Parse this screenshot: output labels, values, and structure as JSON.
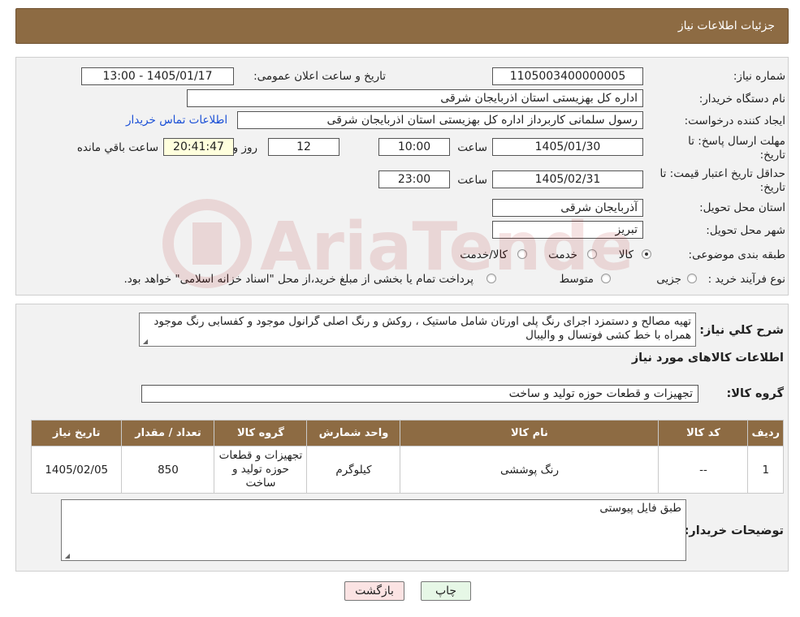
{
  "header": {
    "title": "جزئیات اطلاعات نیاز"
  },
  "form": {
    "need_number_label": "شماره نیاز:",
    "need_number": "1105003400000005",
    "announce_label": "تاریخ و ساعت اعلان عمومی:",
    "announce_value": "1405/01/17 - 13:00",
    "buyer_org_label": "نام دستگاه خریدار:",
    "buyer_org": "اداره کل بهزیستی استان اذربایجان شرقی",
    "requester_label": "ایجاد کننده درخواست:",
    "requester": "رسول سلمانی کاربرداز اداره کل بهزیستی استان اذربایجان شرقی",
    "contact_link": "اطلاعات تماس خریدار",
    "send_deadline_label_line1": "مهلت ارسال پاسخ: تا",
    "send_deadline_label_line2": "تاریخ:",
    "send_date": "1405/01/30",
    "time_label": "ساعت",
    "send_time": "10:00",
    "days_value": "12",
    "days_label": "روز و",
    "remaining_time": "20:41:47",
    "remaining_label": "ساعت باقي مانده",
    "price_validity_label_line1": "حداقل تاریخ اعتبار قیمت: تا",
    "price_validity_label_line2": "تاریخ:",
    "validity_date": "1405/02/31",
    "validity_time": "23:00",
    "province_label": "استان محل تحویل:",
    "province": "آذربایجان شرقی",
    "city_label": "شهر محل تحویل:",
    "city": "تبریز",
    "category_label": "طبقه بندی موضوعی:",
    "category_options": [
      "کالا",
      "خدمت",
      "کالا/خدمت"
    ],
    "process_label": "نوع فرآیند خرید :",
    "process_options": [
      "جزیی",
      "متوسط"
    ],
    "process_note": "پرداخت تمام یا بخشی از مبلغ خرید،از محل \"اسناد خزانه اسلامی\" خواهد بود."
  },
  "description": {
    "label": "شرح كلي نياز:",
    "text": "تهیه مصالح و دستمزد اجرای رنگ پلی اورتان شامل ماستیک ، روکش و رنگ اصلی گرانول موجود و کفسابی رنگ موجود همراه با خط کشی فوتسال و والیبال"
  },
  "goods": {
    "section_title": "اطلاعات کالاهای مورد نیاز",
    "group_label": "گروه کالا:",
    "group_value": "تجهیزات و قطعات حوزه تولید و ساخت",
    "columns": [
      "ردیف",
      "کد کالا",
      "نام کالا",
      "واحد شمارش",
      "گروه کالا",
      "تعداد / مقدار",
      "تاریخ نیاز"
    ],
    "rows": [
      [
        "1",
        "--",
        "رنگ پوششی",
        "کیلوگرم",
        "تجهیزات و قطعات حوزه تولید و ساخت",
        "850",
        "1405/02/05"
      ]
    ]
  },
  "buyer_notes": {
    "label": "توضیحات خریدار:",
    "text": "طبق فایل پیوستی"
  },
  "buttons": {
    "print": "چاپ",
    "back": "بازگشت"
  },
  "watermark": {
    "text": "AriaTender.neT"
  },
  "colors": {
    "header": "#8d6b43",
    "panel": "#f2f2f2",
    "link": "#1a4fd6",
    "print_btn": "#e6f7e6",
    "back_btn": "#fbe3e3"
  }
}
